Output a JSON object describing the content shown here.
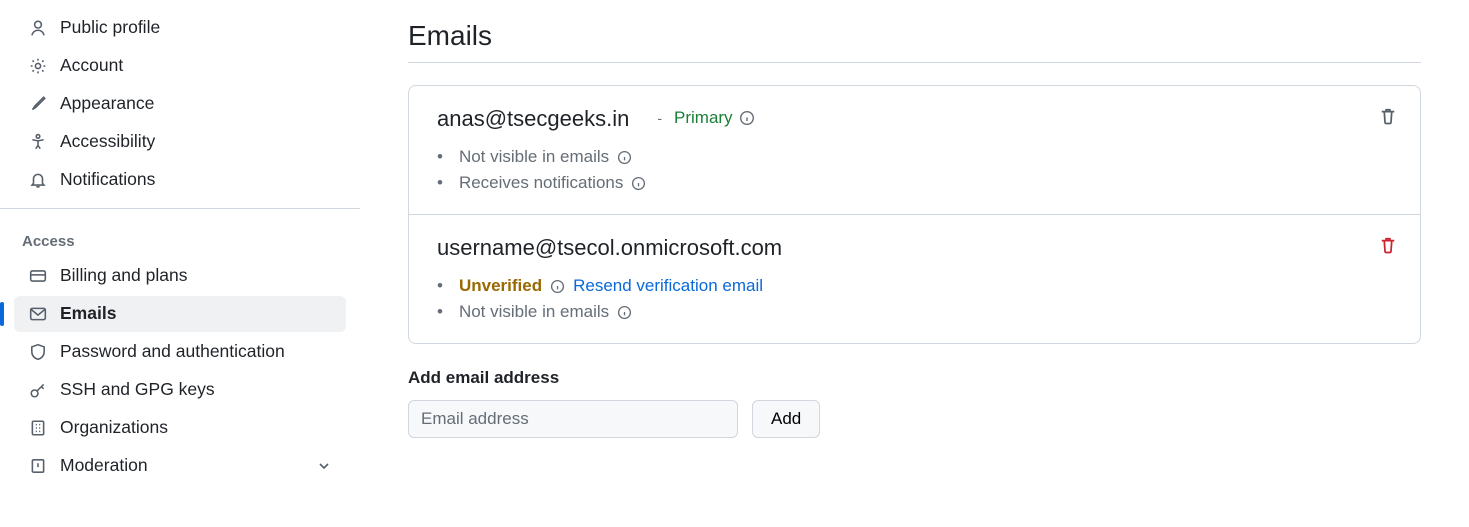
{
  "sidebar": {
    "items": [
      {
        "label": "Public profile"
      },
      {
        "label": "Account"
      },
      {
        "label": "Appearance"
      },
      {
        "label": "Accessibility"
      },
      {
        "label": "Notifications"
      }
    ],
    "group_label": "Access",
    "access_items": [
      {
        "label": "Billing and plans"
      },
      {
        "label": "Emails"
      },
      {
        "label": "Password and authentication"
      },
      {
        "label": "SSH and GPG keys"
      },
      {
        "label": "Organizations"
      },
      {
        "label": "Moderation"
      }
    ]
  },
  "page": {
    "title": "Emails"
  },
  "emails": [
    {
      "address": "anas@tsecgeeks.in",
      "primary_label": "Primary",
      "bullets": [
        {
          "text": "Not visible in emails",
          "class": ""
        },
        {
          "text": "Receives notifications",
          "class": ""
        }
      ]
    },
    {
      "address": "username@tsecol.onmicrosoft.com",
      "bullets": [
        {
          "text": "Unverified",
          "class": "unverified",
          "link_text": "Resend verification email"
        },
        {
          "text": "Not visible in emails",
          "class": ""
        }
      ]
    }
  ],
  "add": {
    "label": "Add email address",
    "placeholder": "Email address",
    "button": "Add"
  }
}
